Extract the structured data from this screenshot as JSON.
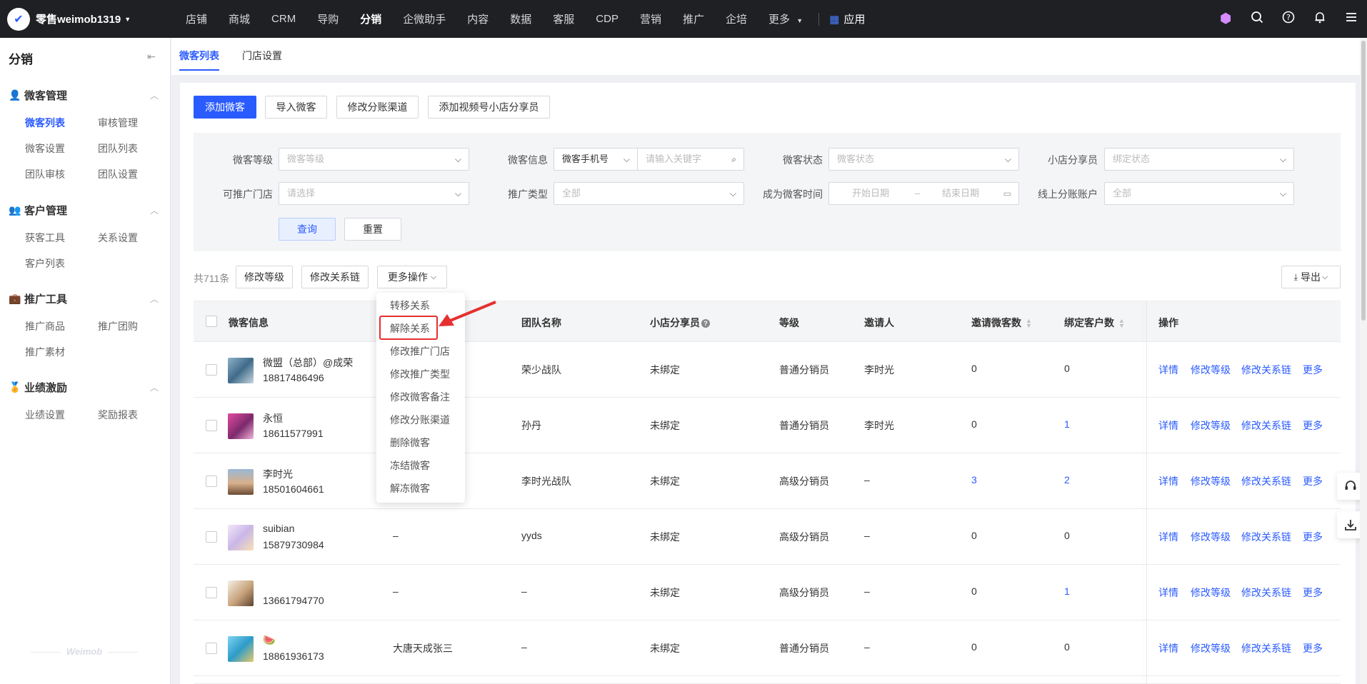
{
  "topbar": {
    "brand": "零售weimob1319",
    "nav": [
      "店铺",
      "商城",
      "CRM",
      "导购",
      "分销",
      "企微助手",
      "内容",
      "数据",
      "客服",
      "CDP",
      "营销",
      "推广",
      "企培",
      "更多"
    ],
    "active_nav": "分销",
    "apps": "应用"
  },
  "sidebar": {
    "title": "分销",
    "groups": [
      {
        "label": "微客管理",
        "items": [
          "微客列表",
          "审核管理",
          "微客设置",
          "团队列表",
          "团队审核",
          "团队设置"
        ]
      },
      {
        "label": "客户管理",
        "items": [
          "获客工具",
          "关系设置",
          "客户列表"
        ]
      },
      {
        "label": "推广工具",
        "items": [
          "推广商品",
          "推广团购",
          "推广素材"
        ]
      },
      {
        "label": "业绩激励",
        "items": [
          "业绩设置",
          "奖励报表"
        ]
      }
    ],
    "active_item": "微客列表",
    "footer": "Weimob"
  },
  "tabs": [
    "微客列表",
    "门店设置"
  ],
  "actions": [
    "添加微客",
    "导入微客",
    "修改分账渠道",
    "添加视频号小店分享员"
  ],
  "filters": {
    "level": {
      "label": "微客等级",
      "placeholder": "微客等级"
    },
    "info": {
      "label": "微客信息",
      "type": "微客手机号",
      "placeholder": "请输入关键字"
    },
    "status": {
      "label": "微客状态",
      "placeholder": "微客状态"
    },
    "sharer": {
      "label": "小店分享员",
      "placeholder": "绑定状态"
    },
    "store": {
      "label": "可推广门店",
      "placeholder": "请选择"
    },
    "promo_type": {
      "label": "推广类型",
      "value": "全部"
    },
    "time": {
      "label": "成为微客时间",
      "start": "开始日期",
      "sep": "–",
      "end": "结束日期"
    },
    "account": {
      "label": "线上分账账户",
      "value": "全部"
    },
    "query": "查询",
    "reset": "重置"
  },
  "list_toolbar": {
    "total": "共711条",
    "buttons": [
      "修改等级",
      "修改关系链",
      "更多操作"
    ],
    "export": "导出"
  },
  "table": {
    "headers": [
      "微客信息",
      "团队名称",
      "小店分享员",
      "等级",
      "邀请人",
      "邀请微客数",
      "绑定客户数",
      "操作"
    ],
    "rows": [
      {
        "name": "微盟（总部）@成荣",
        "phone": "18817486496",
        "col2": "",
        "team": "荣少战队",
        "sharer": "未绑定",
        "level": "普通分销员",
        "inviter": "李时光",
        "invited": "0",
        "bound": "0"
      },
      {
        "name": "永恒",
        "phone": "18611577991",
        "col2": "",
        "team": "孙丹",
        "sharer": "未绑定",
        "level": "普通分销员",
        "inviter": "李时光",
        "invited": "0",
        "bound": "1"
      },
      {
        "name": "李时光",
        "phone": "18501604661",
        "col2": "",
        "team": "李时光战队",
        "sharer": "未绑定",
        "level": "高级分销员",
        "inviter": "–",
        "invited": "3",
        "bound": "2"
      },
      {
        "name": "suibian",
        "phone": "15879730984",
        "col2": "–",
        "team": "yyds",
        "sharer": "未绑定",
        "level": "高级分销员",
        "inviter": "–",
        "invited": "0",
        "bound": "0"
      },
      {
        "name": "",
        "phone": "13661794770",
        "col2": "–",
        "team": "–",
        "sharer": "未绑定",
        "level": "高级分销员",
        "inviter": "–",
        "invited": "0",
        "bound": "1"
      },
      {
        "name": "🍉",
        "phone": "18861936173",
        "col2": "大唐天成张三",
        "team": "–",
        "sharer": "未绑定",
        "level": "普通分销员",
        "inviter": "–",
        "invited": "0",
        "bound": "0"
      }
    ],
    "row_ops": [
      "详情",
      "修改等级",
      "修改关系链",
      "更多"
    ]
  },
  "dropdown": [
    "转移关系",
    "解除关系",
    "修改推广门店",
    "修改推广类型",
    "修改微客备注",
    "修改分账渠道",
    "删除微客",
    "冻结微客",
    "解冻微客"
  ],
  "colors": {
    "accent": "#2a5bff",
    "topbar": "#1f2024",
    "highlight": "#e5302f"
  }
}
